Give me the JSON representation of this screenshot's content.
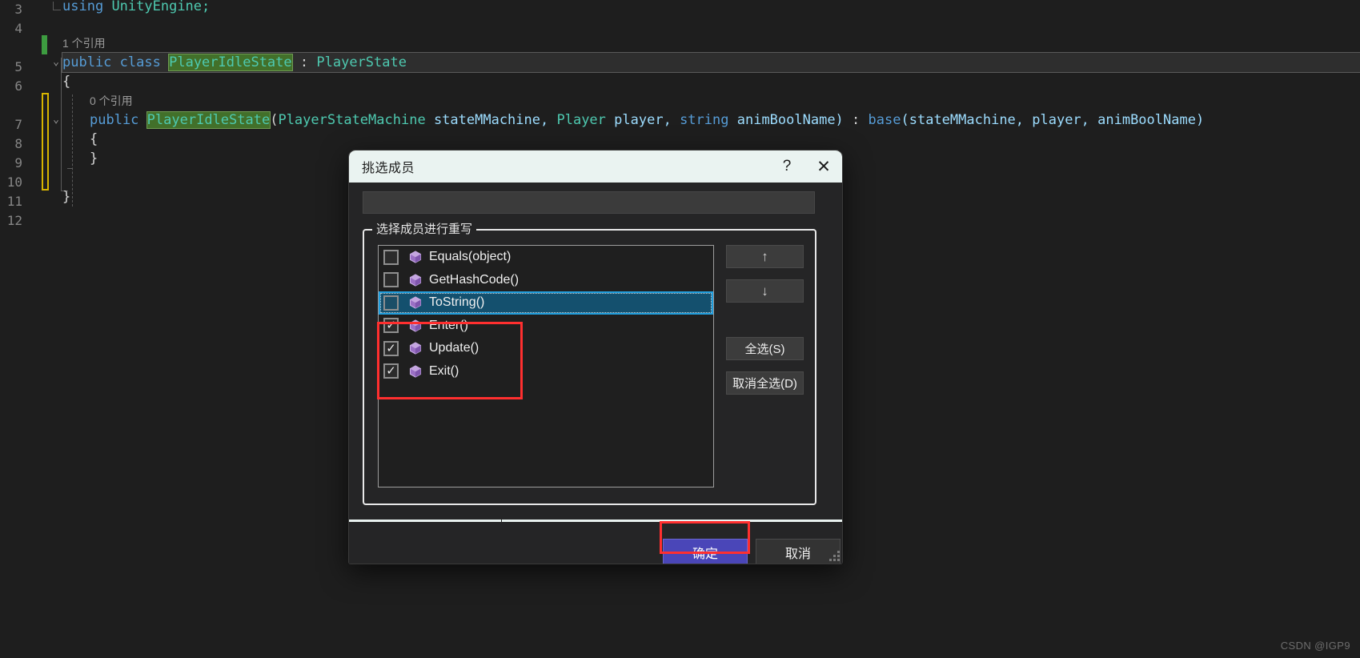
{
  "editor": {
    "line_numbers": [
      "3",
      "4",
      "",
      "5",
      "6",
      "",
      "7",
      "8",
      "9",
      "10",
      "11",
      "12"
    ],
    "lines": [
      {
        "num": "3",
        "text": "using UnityEngine;"
      },
      {
        "num": "5",
        "text": "public class PlayerIdleState : PlayerState"
      },
      {
        "num": "6",
        "text": "{"
      },
      {
        "num": "7",
        "text": "public PlayerIdleState(PlayerStateMachine stateMMachine, Player player, string animBoolName) : base(stateMMachine, player, animBoolName)"
      },
      {
        "num": "8",
        "text": "{"
      },
      {
        "num": "9",
        "text": "}"
      },
      {
        "num": "11",
        "text": "}"
      }
    ],
    "codelens_class": "1 个引用",
    "codelens_ctor": "0 个引用",
    "tokens": {
      "using": "using",
      "unityengine": "UnityEngine;",
      "public": "public",
      "class": "class",
      "player_idle_state": "PlayerIdleState",
      "colon": ":",
      "player_state": "PlayerState",
      "open_brace": "{",
      "close_brace": "}",
      "ctor_open_paren": "(",
      "param_type_1": "PlayerStateMachine",
      "param_name_1": "stateMMachine,",
      "param_type_2": "Player",
      "param_name_2": "player,",
      "param_type_3": "string",
      "param_name_3": "animBoolName)",
      "base_kw": "base",
      "base_args": "(stateMMachine, player, animBoolName)"
    },
    "fold_glyph": "⌄"
  },
  "dialog": {
    "title": "挑选成员",
    "help_label": "?",
    "close_label": "✕",
    "filter": {
      "value": "",
      "placeholder": ""
    },
    "group_label": "选择成员进行重写",
    "members": [
      {
        "label": "Equals(object)",
        "checked": false,
        "selected": false
      },
      {
        "label": "GetHashCode()",
        "checked": false,
        "selected": false
      },
      {
        "label": "ToString()",
        "checked": false,
        "selected": true
      },
      {
        "label": "Enter()",
        "checked": true,
        "selected": false
      },
      {
        "label": "Update()",
        "checked": true,
        "selected": false
      },
      {
        "label": "Exit()",
        "checked": true,
        "selected": false
      }
    ],
    "check_glyph": "✓",
    "side_buttons": [
      {
        "name": "move-up",
        "label": "↑"
      },
      {
        "name": "move-down",
        "label": "↓"
      },
      {
        "name": "select-all",
        "label": "全选(S)"
      },
      {
        "name": "deselect-all",
        "label": "取消全选(D)"
      }
    ],
    "footer_buttons": [
      {
        "name": "ok",
        "label": "确定"
      },
      {
        "name": "cancel",
        "label": "取消"
      }
    ]
  },
  "annotations": {
    "method_box_color": "#ff2f2f",
    "ok_box_color": "#ff2f2f"
  },
  "watermark": "CSDN @IGP9",
  "colors": {
    "editor_bg": "#1e1e1e",
    "dialog_bg": "#252526",
    "titlebar_bg": "#eaf3f1",
    "selection_bg": "#14506e",
    "selection_border": "#1f9ede",
    "primary_button": "#4a46b8",
    "highlight_green": "#42702a",
    "keyword_blue": "#569cd6",
    "type_teal": "#4ec9b0",
    "identifier_blue": "#9cdcfe",
    "method_icon_purple": "#b18bd8",
    "change_bar_green": "#3d9c40",
    "change_bar_yellow": "#d7b500"
  }
}
